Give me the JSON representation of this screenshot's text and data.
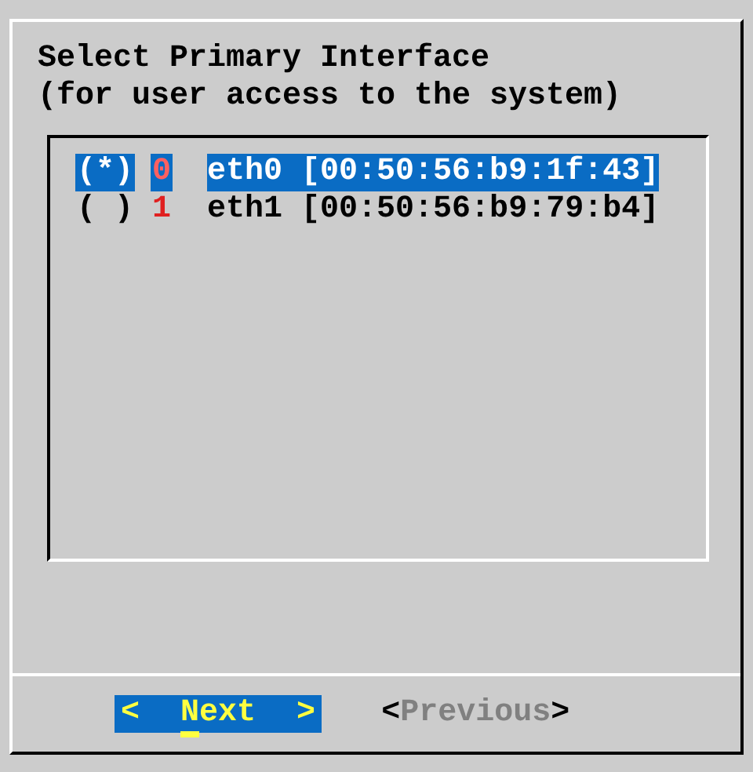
{
  "dialog": {
    "title_lines": [
      "Select Primary Interface",
      "(for user access to the system)"
    ]
  },
  "interfaces": [
    {
      "marker": "(*)",
      "index": "0",
      "label": "eth0 [00:50:56:b9:1f:43]",
      "selected": true
    },
    {
      "marker": "( )",
      "index": "1",
      "label": "eth1 [00:50:56:b9:79:b4]",
      "selected": false
    }
  ],
  "buttons": [
    {
      "open": "<",
      "label": "Next",
      "close": ">",
      "selected": true,
      "disabled": false,
      "hotkey": true
    },
    {
      "open": "<",
      "label": "Previous",
      "close": ">",
      "selected": false,
      "disabled": true,
      "hotkey": false
    }
  ]
}
